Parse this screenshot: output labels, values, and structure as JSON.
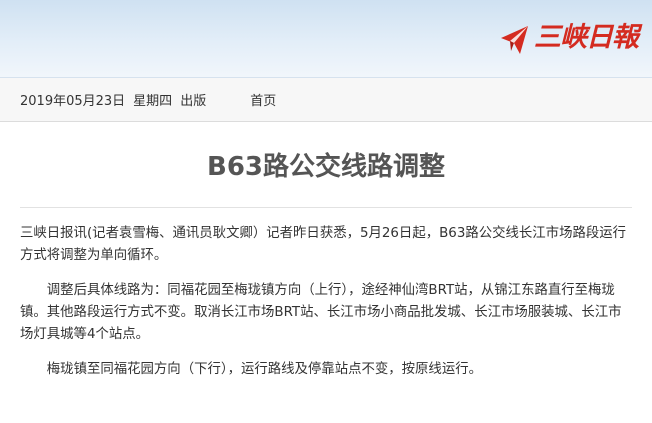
{
  "header": {
    "logo_text": "三峡日報",
    "logo_icon": "paper-plane-logo-icon",
    "brand_color": "#d42b20"
  },
  "infobar": {
    "date": "2019年05月23日",
    "weekday": "星期四",
    "edition": "出版",
    "home_link": "首页"
  },
  "article": {
    "title": "B63路公交线路调整",
    "paragraphs": [
      "三峡日报讯(记者袁雪梅、通讯员耿文卿）记者昨日获悉，5月26日起，B63路公交线长江市场路段运行方式将调整为单向循环。",
      "调整后具体线路为：同福花园至梅珑镇方向（上行），途经神仙湾BRT站，从锦江东路直行至梅珑镇。其他路段运行方式不变。取消长江市场BRT站、长江市场小商品批发城、长江市场服装城、长江市场灯具城等4个站点。",
      "梅珑镇至同福花园方向（下行），运行路线及停靠站点不变，按原线运行。"
    ]
  }
}
